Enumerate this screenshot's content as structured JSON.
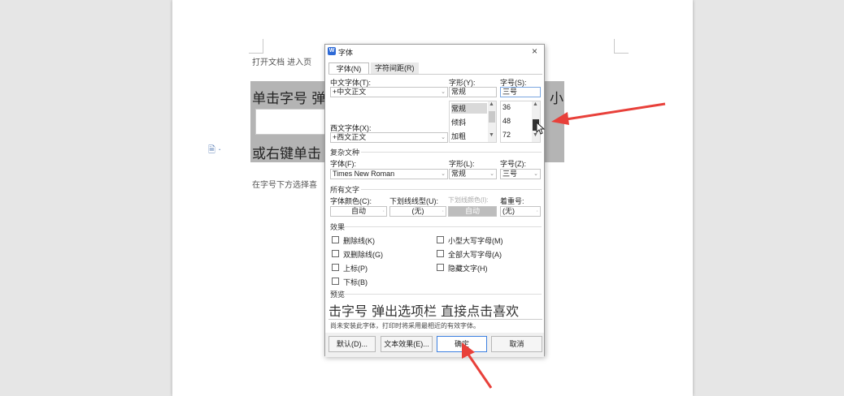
{
  "document": {
    "line1": "打开文档   进入页",
    "line2_left": "单击字号  弹",
    "line2_right": "小",
    "line3": "或右键单击",
    "line4": "在字号下方选择喜",
    "side_icon": "🗎 ·"
  },
  "dialog": {
    "title": "字体",
    "app_logo": "W",
    "close_glyph": "×",
    "tabs": [
      "字体(N)",
      "字符间距(R)"
    ],
    "labels": {
      "cn_font": "中文字体(T):",
      "style": "字形(Y):",
      "size": "字号(S):",
      "west_font": "西文字体(X):",
      "complex_section": "复杂文种",
      "complex_font": "字体(F):",
      "complex_style": "字形(L):",
      "complex_size": "字号(Z):",
      "all_text_section": "所有文字",
      "font_color": "字体颜色(C):",
      "underline_type": "下划线线型(U):",
      "underline_color": "下划线颜色(I):",
      "emphasis": "着重号:",
      "effects_section": "效果",
      "preview_section": "预览"
    },
    "values": {
      "cn_font": "+中文正文",
      "style": "常规",
      "size": "三号",
      "west_font": "+西文正文",
      "complex_font": "Times New Roman",
      "complex_style": "常规",
      "complex_size": "三号",
      "font_color": "自动",
      "underline_type": "(无)",
      "underline_color": "自动",
      "emphasis": "(无)"
    },
    "style_list": [
      "常规",
      "倾斜",
      "加粗"
    ],
    "size_list": [
      "36",
      "48",
      "72"
    ],
    "effects_left": [
      "删除线(K)",
      "双删除线(G)",
      "上标(P)",
      "下标(B)"
    ],
    "effects_right": [
      "小型大写字母(M)",
      "全部大写字母(A)",
      "隐藏文字(H)"
    ],
    "preview_text": "击字号  弹出选项栏  直接点击喜欢",
    "note": "尚未安装此字体，打印时将采用最相近的有效字体。",
    "buttons": {
      "default": "默认(D)...",
      "text_effect": "文本效果(E)...",
      "ok": "确定",
      "cancel": "取消"
    }
  },
  "colors": {
    "arrow": "#e8403a",
    "accent": "#2e6ad6"
  }
}
